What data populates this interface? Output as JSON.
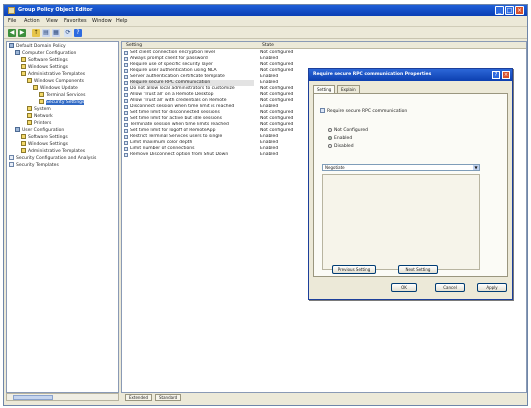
{
  "window": {
    "title": "Group Policy Object Editor",
    "minimize_glyph": "_",
    "maximize_glyph": "□",
    "close_glyph": "×"
  },
  "menu": [
    "File",
    "Action",
    "View",
    "Favorites",
    "Window",
    "Help"
  ],
  "toolbar": {
    "back_glyph": "◀",
    "forward_glyph": "▶",
    "up_glyph": "↑",
    "show_tree_glyph": "▤",
    "properties_glyph": "▦",
    "help_glyph": "?",
    "refresh_glyph": "⟳"
  },
  "tree": {
    "items": [
      {
        "label": "Default Domain Policy",
        "depth": 0,
        "kind": "pc"
      },
      {
        "label": "Computer Configuration",
        "depth": 1,
        "kind": "pc"
      },
      {
        "label": "Software Settings",
        "depth": 2,
        "kind": "folder"
      },
      {
        "label": "Windows Settings",
        "depth": 2,
        "kind": "folder"
      },
      {
        "label": "Administrative Templates",
        "depth": 2,
        "kind": "folder"
      },
      {
        "label": "Windows Components",
        "depth": 3,
        "kind": "folder"
      },
      {
        "label": "Windows Update",
        "depth": 4,
        "kind": "folder"
      },
      {
        "label": "Terminal Services",
        "depth": 5,
        "kind": "folder"
      },
      {
        "label": "Security Settings",
        "depth": 5,
        "kind": "folder",
        "selected": true
      },
      {
        "label": "System",
        "depth": 3,
        "kind": "folder"
      },
      {
        "label": "Network",
        "depth": 3,
        "kind": "folder"
      },
      {
        "label": "Printers",
        "depth": 3,
        "kind": "folder"
      },
      {
        "label": "User Configuration",
        "depth": 1,
        "kind": "pc"
      },
      {
        "label": "Software Settings",
        "depth": 2,
        "kind": "folder"
      },
      {
        "label": "Windows Settings",
        "depth": 2,
        "kind": "folder"
      },
      {
        "label": "Administrative Templates",
        "depth": 2,
        "kind": "folder"
      },
      {
        "label": "Security Configuration and Analysis",
        "depth": 0,
        "kind": "doc"
      },
      {
        "label": "Security Templates",
        "depth": 0,
        "kind": "doc"
      }
    ]
  },
  "list": {
    "columns": [
      "Setting",
      "State"
    ],
    "rows": [
      {
        "name": "Set client connection encryption level",
        "state": "Not configured"
      },
      {
        "name": "Always prompt client for password",
        "state": "Enabled"
      },
      {
        "name": "Require use of specific security layer",
        "state": "Not configured"
      },
      {
        "name": "Require user authentication using NLA",
        "state": "Not configured"
      },
      {
        "name": "Server authentication certificate template",
        "state": "Enabled"
      },
      {
        "name": "Require secure RPC communication",
        "state": "Enabled",
        "selected": true
      },
      {
        "name": "Do not allow local administrators to customize",
        "state": "Not configured"
      },
      {
        "name": "Allow 'Trust all' on a Remote Desktop",
        "state": "Not configured"
      },
      {
        "name": "Allow 'Trust all' with credentials on Remote",
        "state": "Not configured"
      },
      {
        "name": "Disconnect session when time limit is reached",
        "state": "Enabled"
      },
      {
        "name": "Set time limit for disconnected sessions",
        "state": "Not configured"
      },
      {
        "name": "Set time limit for active but idle sessions",
        "state": "Not configured"
      },
      {
        "name": "Terminate session when time limits reached",
        "state": "Not configured"
      },
      {
        "name": "Set time limit for logoff of RemoteApp",
        "state": "Not configured"
      },
      {
        "name": "Restrict Terminal Services users to single",
        "state": "Enabled"
      },
      {
        "name": "Limit maximum color depth",
        "state": "Enabled"
      },
      {
        "name": "Limit number of connections",
        "state": "Enabled"
      },
      {
        "name": "Remove Disconnect option from Shut Down",
        "state": "Enabled"
      }
    ]
  },
  "bottom_tabs": [
    "Extended",
    "Standard"
  ],
  "dialog": {
    "title": "Require secure RPC communication Properties",
    "help_glyph": "?",
    "close_glyph": "×",
    "tabs": [
      "Setting",
      "Explain"
    ],
    "setting_name": "Require secure RPC communication",
    "radios": [
      {
        "label": "Not Configured",
        "checked": false
      },
      {
        "label": "Enabled",
        "checked": true
      },
      {
        "label": "Disabled",
        "checked": false
      }
    ],
    "select_value": "Negotiate",
    "select_arrow": "▼",
    "prev_button": "Previous Setting",
    "next_button": "Next Setting",
    "ok_button": "OK",
    "cancel_button": "Cancel",
    "apply_button": "Apply"
  },
  "colors": {
    "titlebar": "#0a3fb4",
    "selection": "#316ac5",
    "close": "#d7502c",
    "chrome": "#ece9d8"
  }
}
